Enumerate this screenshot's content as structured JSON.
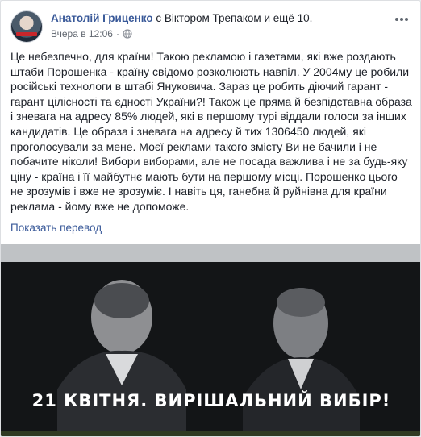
{
  "post": {
    "author": "Анатолій Гриценко",
    "with_text": "с Віктором Трепаком и ещё 10.",
    "timestamp": "Вчера в 12:06",
    "separator": "·",
    "privacy_icon": "globe-icon",
    "more_icon": "more-horizontal-icon",
    "body": "Це небезпечно, для країни! Такою рекламою і газетами, які вже роздають штаби Порошенка - країну свідомо розколюють навпіл. У 2004му це робили російські технологи в штабі Януковича. Зараз це робить діючий гарант - гарант цілісності та єдності України?! Також це пряма й безпідставна образа і зневага на адресу 85% людей, які в першому турі віддали голоси за інших кандидатів. Це образа і зневага на адресу й тих 1306450 людей, які проголосували за мене. Моєї реклами такого змісту Ви не бачили і не побачите ніколи! Вибори виборами, але не посада важлива і не за будь-яку ціну - країна і її майбутнє мають бути на першому місці. Порошенко цього не зрозумів і вже не зрозуміє. І навіть ця, ганебна й руйнівна для країни реклама - йому вже не допоможе.",
    "translate_link": "Показать перевод"
  },
  "photo": {
    "billboard_text": "21 КВІТНЯ. ВИРІШАЛЬНИЙ ВИБІР!"
  },
  "colors": {
    "link": "#385898",
    "text": "#1d2129",
    "meta": "#616770"
  }
}
